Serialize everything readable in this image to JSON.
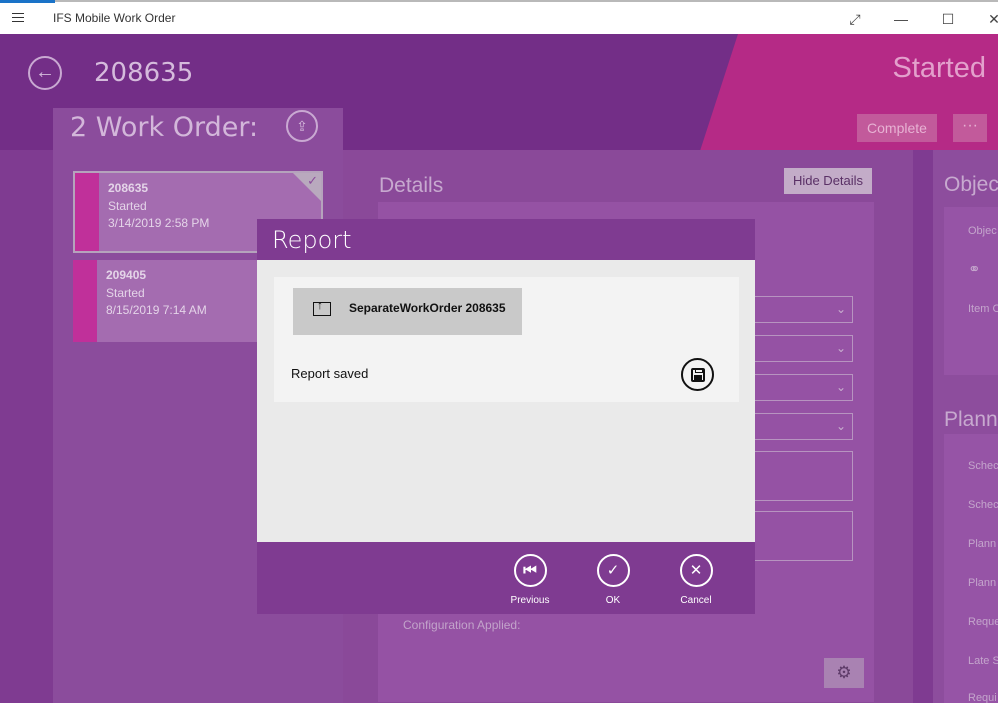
{
  "window": {
    "title": "IFS Mobile Work Order",
    "controls": {
      "fullscreen": "⤢",
      "minimize": "—",
      "maximize": "☐",
      "close": "✕"
    }
  },
  "header": {
    "back_icon": "←",
    "work_order_number": "208635",
    "status": "Started",
    "complete_label": "Complete",
    "more_label": "···"
  },
  "left_panel": {
    "title": "2 Work Order:",
    "upload_icon": "⇪",
    "work_orders": [
      {
        "number": "208635",
        "status": "Started",
        "date": "3/14/2019 2:58 PM",
        "selected": true
      },
      {
        "number": "209405",
        "status": "Started",
        "date": "8/15/2019 7:14 AM",
        "selected": false
      }
    ]
  },
  "details": {
    "title": "Details",
    "hide_label": "Hide Details",
    "config_label": "Configuration Applied:",
    "gear_icon": "⚙"
  },
  "right_column": {
    "object_heading": "Objec",
    "object_label": "Objec",
    "link_icon": "⚭",
    "item_label": "Item C",
    "planning_heading": "Plann",
    "labels": [
      "Schec",
      "Schec",
      "Plann",
      "Plann",
      "Reque",
      "Late S",
      "Requi"
    ]
  },
  "dialog": {
    "title": "Report",
    "report_button_label": "SeparateWorkOrder 208635",
    "saved_text": "Report saved",
    "buttons": {
      "previous": {
        "label": "Previous",
        "icon": "⏮"
      },
      "ok": {
        "label": "OK",
        "icon": "✓"
      },
      "cancel": {
        "label": "Cancel",
        "icon": "✕"
      }
    }
  }
}
